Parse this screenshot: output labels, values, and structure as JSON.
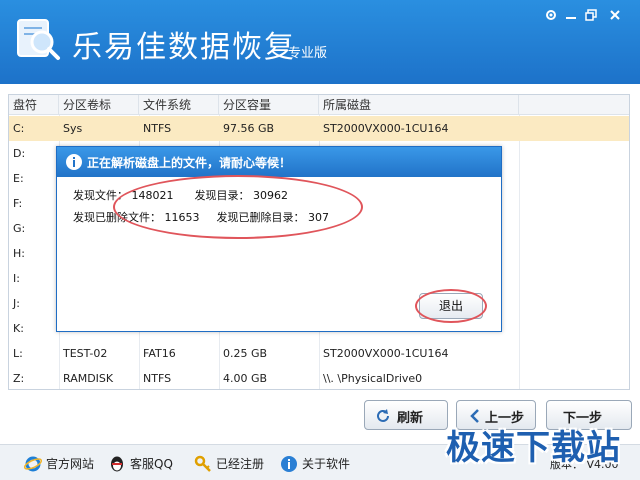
{
  "header": {
    "title": "乐易佳数据恢复",
    "edition": "专业版",
    "logo_icon": "magnifier-disk-icon"
  },
  "window_controls": {
    "settings_icon": "gear-icon",
    "minimize_icon": "minimize-icon",
    "maximize_icon": "maximize-icon",
    "close_icon": "close-icon"
  },
  "table": {
    "columns": [
      "盘符",
      "分区卷标",
      "文件系统",
      "分区容量",
      "所属磁盘"
    ],
    "rows": [
      {
        "drive": "C:",
        "label": "Sys",
        "fs": "NTFS",
        "size": "97.56 GB",
        "disk": "ST2000VX000-1CU164",
        "selected": true
      },
      {
        "drive": "D:",
        "label": "",
        "fs": "",
        "size": "",
        "disk": ""
      },
      {
        "drive": "E:",
        "label": "",
        "fs": "",
        "size": "",
        "disk": ""
      },
      {
        "drive": "F:",
        "label": "",
        "fs": "",
        "size": "",
        "disk": ""
      },
      {
        "drive": "G:",
        "label": "",
        "fs": "",
        "size": "",
        "disk": ""
      },
      {
        "drive": "H:",
        "label": "",
        "fs": "",
        "size": "",
        "disk": ""
      },
      {
        "drive": "I:",
        "label": "",
        "fs": "",
        "size": "",
        "disk": ""
      },
      {
        "drive": "J:",
        "label": "",
        "fs": "",
        "size": "",
        "disk": ""
      },
      {
        "drive": "K:",
        "label": "",
        "fs": "",
        "size": "",
        "disk": ""
      },
      {
        "drive": "L:",
        "label": "TEST-02",
        "fs": "FAT16",
        "size": "0.25 GB",
        "disk": "ST2000VX000-1CU164"
      },
      {
        "drive": "Z:",
        "label": "RAMDISK",
        "fs": "NTFS",
        "size": "4.00 GB",
        "disk": "\\\\. \\PhysicalDrive0"
      }
    ]
  },
  "dialog": {
    "title": "正在解析磁盘上的文件，请耐心等候！",
    "found_files_label": "发现文件：",
    "found_files": "148021",
    "found_dirs_label": "发现目录：",
    "found_dirs": "30962",
    "deleted_files_label": "发现已删除文件：",
    "deleted_files": "11653",
    "deleted_dirs_label": "发现已删除目录：",
    "deleted_dirs": "307",
    "exit_label": "退出",
    "icon": "info-icon"
  },
  "actions": {
    "refresh_label": "刷新",
    "prev_label": "上一步",
    "next_label": "下一步"
  },
  "footer": {
    "website": "官方网站",
    "qq": "客服QQ",
    "registered": "已经注册",
    "about": "关于软件",
    "version": "版本： V4.00"
  },
  "watermark": "极速下载站",
  "colors": {
    "header": "#1d72c9",
    "selected_row": "#fbeac2",
    "annotation": "#e0555b"
  }
}
